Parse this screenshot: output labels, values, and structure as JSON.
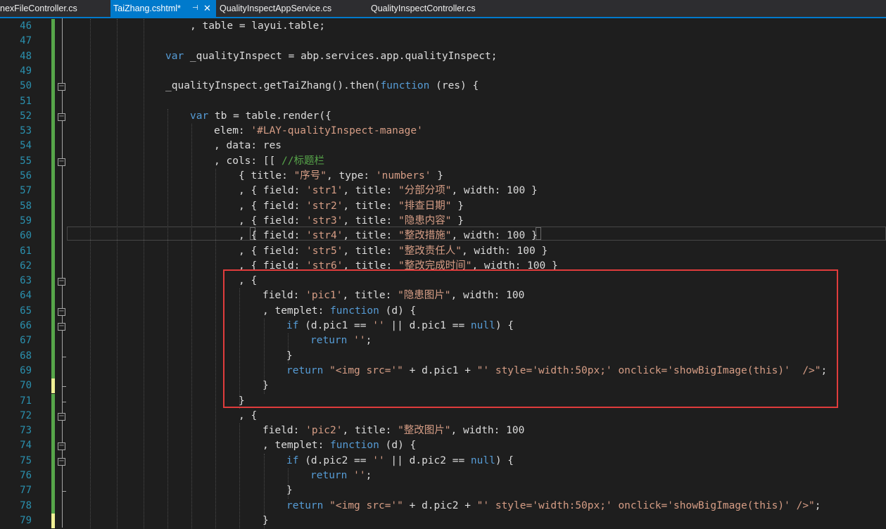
{
  "tabs": [
    {
      "label": "nexFileController.cs",
      "active": false
    },
    {
      "label": "TaiZhang.cshtml*",
      "active": true,
      "pin_icon": "pin-icon",
      "close_icon": "close-icon"
    },
    {
      "label": "QualityInspectAppService.cs",
      "active": false
    },
    {
      "label": "QualityInspectController.cs",
      "active": false
    }
  ],
  "tab_glyphs": {
    "pin": "⊣",
    "close": "✕"
  },
  "line_numbers": [
    "46",
    "47",
    "48",
    "49",
    "50",
    "51",
    "52",
    "53",
    "54",
    "55",
    "56",
    "57",
    "58",
    "59",
    "60",
    "61",
    "62",
    "63",
    "64",
    "65",
    "66",
    "67",
    "68",
    "69",
    "70",
    "71",
    "72",
    "73",
    "74",
    "75",
    "76",
    "77",
    "78",
    "79"
  ],
  "code_lines": [
    [
      {
        "t": ", table = layui.table;",
        "c": "pl"
      }
    ],
    [],
    [
      {
        "t": "var",
        "c": "kw"
      },
      {
        "t": " _qualityInspect = abp.services.app.qualityInspect;",
        "c": "pl"
      }
    ],
    [],
    [
      {
        "t": "_qualityInspect.getTaiZhang().then(",
        "c": "pl"
      },
      {
        "t": "function",
        "c": "kw"
      },
      {
        "t": " (res) {",
        "c": "pl"
      }
    ],
    [],
    [
      {
        "t": "var",
        "c": "kw"
      },
      {
        "t": " tb = table.render({",
        "c": "pl"
      }
    ],
    [
      {
        "t": "elem: ",
        "c": "pl"
      },
      {
        "t": "'#LAY-qualityInspect-manage'",
        "c": "str"
      }
    ],
    [
      {
        "t": ", data: res",
        "c": "pl"
      }
    ],
    [
      {
        "t": ", cols: [[ ",
        "c": "pl"
      },
      {
        "t": "//标题栏",
        "c": "cm"
      }
    ],
    [
      {
        "t": "{ title: ",
        "c": "pl"
      },
      {
        "t": "\"序号\"",
        "c": "str"
      },
      {
        "t": ", type: ",
        "c": "pl"
      },
      {
        "t": "'numbers'",
        "c": "str"
      },
      {
        "t": " }",
        "c": "pl"
      }
    ],
    [
      {
        "t": ", { field: ",
        "c": "pl"
      },
      {
        "t": "'str1'",
        "c": "str"
      },
      {
        "t": ", title: ",
        "c": "pl"
      },
      {
        "t": "\"分部分项\"",
        "c": "str"
      },
      {
        "t": ", width: 100 }",
        "c": "pl"
      }
    ],
    [
      {
        "t": ", { field: ",
        "c": "pl"
      },
      {
        "t": "'str2'",
        "c": "str"
      },
      {
        "t": ", title: ",
        "c": "pl"
      },
      {
        "t": "\"排查日期\"",
        "c": "str"
      },
      {
        "t": " }",
        "c": "pl"
      }
    ],
    [
      {
        "t": ", { field: ",
        "c": "pl"
      },
      {
        "t": "'str3'",
        "c": "str"
      },
      {
        "t": ", title: ",
        "c": "pl"
      },
      {
        "t": "\"隐患内容\"",
        "c": "str"
      },
      {
        "t": " }",
        "c": "pl"
      }
    ],
    [
      {
        "t": ", { field: ",
        "c": "pl"
      },
      {
        "t": "'str4'",
        "c": "str"
      },
      {
        "t": ", title: ",
        "c": "pl"
      },
      {
        "t": "\"整改措施\"",
        "c": "str"
      },
      {
        "t": ", width: 100 }",
        "c": "pl"
      }
    ],
    [
      {
        "t": ", { field: ",
        "c": "pl"
      },
      {
        "t": "'str5'",
        "c": "str"
      },
      {
        "t": ", title: ",
        "c": "pl"
      },
      {
        "t": "\"整改责任人\"",
        "c": "str"
      },
      {
        "t": ", width: 100 }",
        "c": "pl"
      }
    ],
    [
      {
        "t": ", { field: ",
        "c": "pl"
      },
      {
        "t": "'str6'",
        "c": "str"
      },
      {
        "t": ", title: ",
        "c": "pl"
      },
      {
        "t": "\"整改完成时间\"",
        "c": "str"
      },
      {
        "t": ", width: 100 }",
        "c": "pl"
      }
    ],
    [
      {
        "t": ", {",
        "c": "pl"
      }
    ],
    [
      {
        "t": "field: ",
        "c": "pl"
      },
      {
        "t": "'pic1'",
        "c": "str"
      },
      {
        "t": ", title: ",
        "c": "pl"
      },
      {
        "t": "\"隐患图片\"",
        "c": "str"
      },
      {
        "t": ", width: 100",
        "c": "pl"
      }
    ],
    [
      {
        "t": ", templet: ",
        "c": "pl"
      },
      {
        "t": "function",
        "c": "kw"
      },
      {
        "t": " (d) {",
        "c": "pl"
      }
    ],
    [
      {
        "t": "if",
        "c": "kw"
      },
      {
        "t": " (d.pic1 == ",
        "c": "pl"
      },
      {
        "t": "''",
        "c": "str"
      },
      {
        "t": " || d.pic1 == ",
        "c": "pl"
      },
      {
        "t": "null",
        "c": "kw"
      },
      {
        "t": ") {",
        "c": "pl"
      }
    ],
    [
      {
        "t": "return",
        "c": "kw"
      },
      {
        "t": " ",
        "c": "pl"
      },
      {
        "t": "''",
        "c": "str"
      },
      {
        "t": ";",
        "c": "pl"
      }
    ],
    [
      {
        "t": "}",
        "c": "pl"
      }
    ],
    [
      {
        "t": "return",
        "c": "kw"
      },
      {
        "t": " ",
        "c": "pl"
      },
      {
        "t": "\"<img src='\"",
        "c": "str"
      },
      {
        "t": " + d.pic1 + ",
        "c": "pl"
      },
      {
        "t": "\"' style='width:50px;' onclick='showBigImage(this)'  />\"",
        "c": "str"
      },
      {
        "t": ";",
        "c": "pl"
      }
    ],
    [
      {
        "t": "}",
        "c": "pl"
      }
    ],
    [
      {
        "t": "}",
        "c": "pl"
      }
    ],
    [
      {
        "t": ", {",
        "c": "pl"
      }
    ],
    [
      {
        "t": "field: ",
        "c": "pl"
      },
      {
        "t": "'pic2'",
        "c": "str"
      },
      {
        "t": ", title: ",
        "c": "pl"
      },
      {
        "t": "\"整改图片\"",
        "c": "str"
      },
      {
        "t": ", width: 100",
        "c": "pl"
      }
    ],
    [
      {
        "t": ", templet: ",
        "c": "pl"
      },
      {
        "t": "function",
        "c": "kw"
      },
      {
        "t": " (d) {",
        "c": "pl"
      }
    ],
    [
      {
        "t": "if",
        "c": "kw"
      },
      {
        "t": " (d.pic2 == ",
        "c": "pl"
      },
      {
        "t": "''",
        "c": "str"
      },
      {
        "t": " || d.pic2 == ",
        "c": "pl"
      },
      {
        "t": "null",
        "c": "kw"
      },
      {
        "t": ") {",
        "c": "pl"
      }
    ],
    [
      {
        "t": "return",
        "c": "kw"
      },
      {
        "t": " ",
        "c": "pl"
      },
      {
        "t": "''",
        "c": "str"
      },
      {
        "t": ";",
        "c": "pl"
      }
    ],
    [
      {
        "t": "}",
        "c": "pl"
      }
    ],
    [
      {
        "t": "return",
        "c": "kw"
      },
      {
        "t": " ",
        "c": "pl"
      },
      {
        "t": "\"<img src='\"",
        "c": "str"
      },
      {
        "t": " + d.pic2 + ",
        "c": "pl"
      },
      {
        "t": "\"' style='width:50px;' onclick='showBigImage(this)' />\"",
        "c": "str"
      },
      {
        "t": ";",
        "c": "pl"
      }
    ],
    [
      {
        "t": "}",
        "c": "pl"
      }
    ]
  ],
  "fold_toggle_glyph": "−",
  "colors": {
    "background": "#1e1e1e",
    "keyword": "#569cd6",
    "string": "#d69d85",
    "comment": "#57a64a",
    "plain": "#dcdcdc",
    "line_number": "#2b91af",
    "active_tab": "#007acc",
    "annotation_box": "#e03c3c"
  }
}
